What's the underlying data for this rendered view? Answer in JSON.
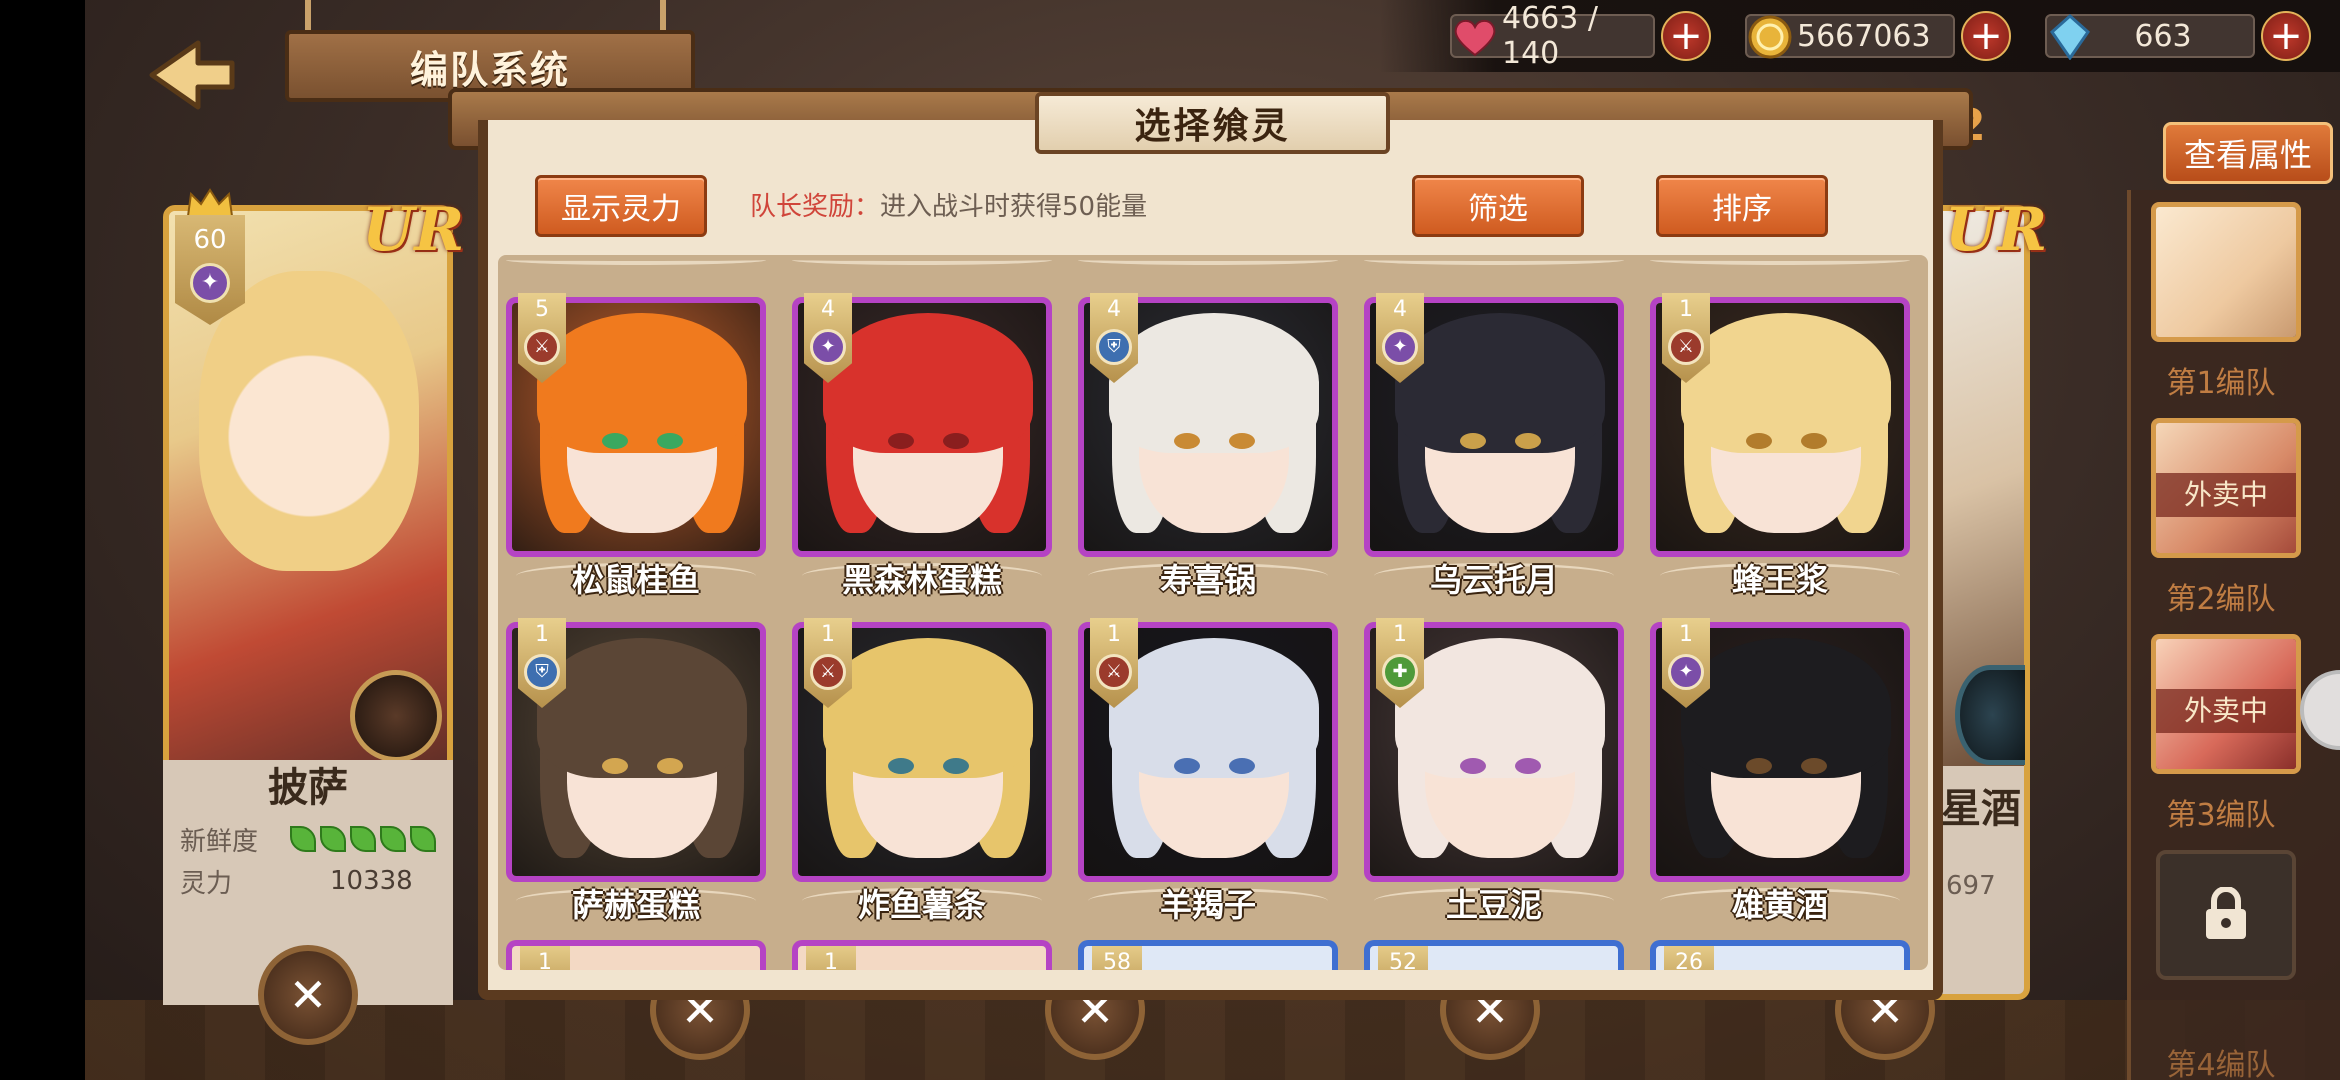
{
  "header": {
    "title": "编队系统",
    "back_icon": "back-arrow-icon"
  },
  "resources": [
    {
      "icon": "heart-icon",
      "value": "4663 / 140"
    },
    {
      "icon": "coin-icon",
      "value": "5667063"
    },
    {
      "icon": "crystal-icon",
      "value": "663"
    }
  ],
  "plus_label": "+",
  "dialog": {
    "title": "选择飨灵",
    "show_power_label": "显示灵力",
    "bonus_key": "队长奖励：",
    "bonus_text": "进入战斗时获得50能量",
    "filter_label": "筛选",
    "sort_label": "排序"
  },
  "cards": [
    {
      "name": "松鼠桂鱼",
      "level": "5",
      "role": "attack",
      "hair": "#f07a1e",
      "eye": "#3aa860",
      "bg": "#c9632e"
    },
    {
      "name": "黑森林蛋糕",
      "level": "4",
      "role": "support",
      "hair": "#d8322c",
      "eye": "#8a1e1e",
      "bg": "#3a2a2a"
    },
    {
      "name": "寿喜锅",
      "level": "4",
      "role": "defense",
      "hair": "#ece8e2",
      "eye": "#c98a34",
      "bg": "#2c2e36"
    },
    {
      "name": "乌云托月",
      "level": "4",
      "role": "support",
      "hair": "#2b2a34",
      "eye": "#caa04a",
      "bg": "#1f1f27"
    },
    {
      "name": "蜂王浆",
      "level": "1",
      "role": "attack",
      "hair": "#f1d58f",
      "eye": "#b27c2c",
      "bg": "#3d2c22"
    },
    {
      "name": "萨赫蛋糕",
      "level": "1",
      "role": "defense",
      "hair": "#5b4636",
      "eye": "#d3a650",
      "bg": "#5a4a3a"
    },
    {
      "name": "炸鱼薯条",
      "level": "1",
      "role": "attack",
      "hair": "#e7c56b",
      "eye": "#3f7a8a",
      "bg": "#2a2a30"
    },
    {
      "name": "羊羯子",
      "level": "1",
      "role": "attack",
      "hair": "#d8dde9",
      "eye": "#4a6fb3",
      "bg": "#181820"
    },
    {
      "name": "土豆泥",
      "level": "1",
      "role": "heal",
      "hair": "#f2e6e0",
      "eye": "#a05ab0",
      "bg": "#4a3b3b"
    },
    {
      "name": "雄黄酒",
      "level": "1",
      "role": "support",
      "hair": "#1d1c1f",
      "eye": "#6b4a2a",
      "bg": "#2b2120"
    }
  ],
  "peek_levels": [
    "1",
    "1",
    "58",
    "52",
    "26"
  ],
  "role_colors": {
    "attack": "#9b3b2c",
    "support": "#7b4ea8",
    "defense": "#3e6fb0",
    "heal": "#4f9a3a"
  },
  "role_glyphs": {
    "attack": "⚔",
    "support": "✦",
    "defense": "⛨",
    "heal": "✚"
  },
  "left_card": {
    "level": "60",
    "rarity": "UR",
    "name": "披萨",
    "freshness_label": "新鲜度",
    "power_label": "灵力",
    "power_value": "10338",
    "fresh_leaves": 5
  },
  "right_card": {
    "rarity": "UR",
    "name_partial": "星酒",
    "power_partial": "697"
  },
  "side_panel": {
    "view_attr_label": "查看属性",
    "teams": [
      {
        "label": "第1编队",
        "status": ""
      },
      {
        "label": "第2编队",
        "status": "外卖中"
      },
      {
        "label": "第3编队",
        "status": "外卖中"
      },
      {
        "label": "第4编队",
        "status": ""
      }
    ],
    "partial_number": "2"
  },
  "colors": {
    "accent_orange": "#e06f30",
    "frame_purple": "#b543c4",
    "panel": "#f1e4cf",
    "wood": "#5b3a1f"
  }
}
